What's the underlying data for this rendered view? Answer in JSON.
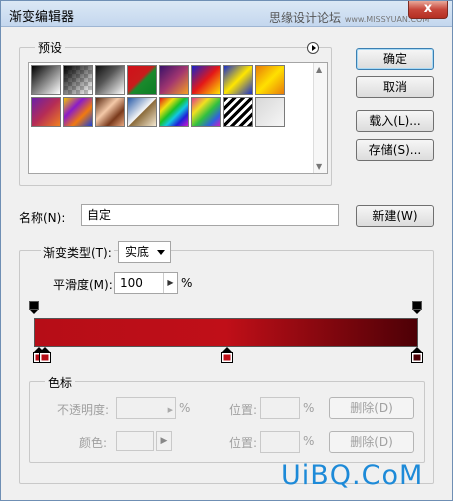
{
  "window": {
    "title": "渐变编辑器",
    "watermark": "思缘设计论坛",
    "watermark_url": "www.MISSYUAN.COM",
    "close_label": "x"
  },
  "presets": {
    "label": "预设",
    "menu_icon": "circle-right-arrow-icon",
    "swatches": [
      {
        "name": "black-white",
        "css": "linear-gradient(135deg,#000 0%,#fff 100%)"
      },
      {
        "name": "black-transparent",
        "css": "linear-gradient(135deg,#000 0%,rgba(0,0,0,0) 100%)"
      },
      {
        "name": "black-to-white-soft",
        "css": "linear-gradient(135deg,#111 0%,#555 40%,#fff 100%)"
      },
      {
        "name": "red-green",
        "css": "linear-gradient(135deg,#d0101a 0%,#c81c1c 45%,#1a8a2c 55%,#0b7d25 100%)"
      },
      {
        "name": "violet-orange",
        "css": "linear-gradient(135deg,#3a1269 0%,#a23670 50%,#f4a023 100%)"
      },
      {
        "name": "blue-red-yellow",
        "css": "linear-gradient(135deg,#1822c8 0%,#e41818 50%,#ffe400 100%)"
      },
      {
        "name": "blue-yellow-blue",
        "css": "linear-gradient(135deg,#1a2fc8 0%,#ffe600 50%,#1a2fc8 100%)"
      },
      {
        "name": "orange-yellow-orange",
        "css": "linear-gradient(135deg,#e87b0a 0%,#ffe000 50%,#e87b0a 100%)"
      },
      {
        "name": "violet-orange-2",
        "css": "linear-gradient(135deg,#6a20a8 0%,#b52c56 50%,#f08020 100%)"
      },
      {
        "name": "yellow-violet-orange-blue",
        "css": "linear-gradient(135deg,#f2c400 0%,#8a1cc8 35%,#f07a10 65%,#1a40d8 100%)"
      },
      {
        "name": "copper",
        "css": "linear-gradient(135deg,#5a2a12 0%,#f4c9a8 40%,#7a3a1c 70%,#e8a880 100%)"
      },
      {
        "name": "chrome",
        "css": "linear-gradient(135deg,#2a5ca8 0%,#f6f6f6 50%,#8a6a3a 52%,#f4e8d0 100%)"
      },
      {
        "name": "spectrum",
        "css": "linear-gradient(135deg,#e01818 0%,#f0e010 25%,#18c028 45%,#10c8e0 60%,#2020d8 78%,#d018d0 100%)"
      },
      {
        "name": "transparent-rainbow",
        "css": "linear-gradient(135deg,#e23a8a 0%,#f0e020 30%,#30c040 55%,#3060e0 80%,#d020c0 100%)"
      },
      {
        "name": "transparent-stripes",
        "css": "repeating-linear-gradient(135deg,#000 0px,#000 3px,#fff 3px,#fff 6px)"
      },
      {
        "name": "neutral-density",
        "css": "linear-gradient(135deg,#d8d8d8 0%,#f6f6f6 100%)"
      }
    ]
  },
  "buttons": {
    "ok": "确定",
    "cancel": "取消",
    "load": "载入(L)...",
    "save": "存储(S)...",
    "new": "新建(W)",
    "delete_opacity": "删除(D)",
    "delete_color": "删除(D)"
  },
  "name_field": {
    "label": "名称(N):",
    "value": "自定"
  },
  "gradient_type": {
    "label": "渐变类型(T):",
    "selected": "实底"
  },
  "smoothness": {
    "label": "平滑度(M):",
    "value": "100",
    "unit": "%"
  },
  "gradient": {
    "colors": [
      "#b60d17",
      "#c00f18",
      "#4d0006"
    ],
    "color_stop_positions": [
      0,
      50,
      100
    ],
    "opacity_stop_positions": [
      0,
      100
    ]
  },
  "color_stops": {
    "label": "色标",
    "opacity_label": "不透明度:",
    "opacity_unit": "%",
    "color_label": "颜色:",
    "location_label_1": "位置:",
    "location_unit_1": "%",
    "location_label_2": "位置:",
    "location_unit_2": "%"
  },
  "watermark_bottom": "UiBQ.CoM"
}
